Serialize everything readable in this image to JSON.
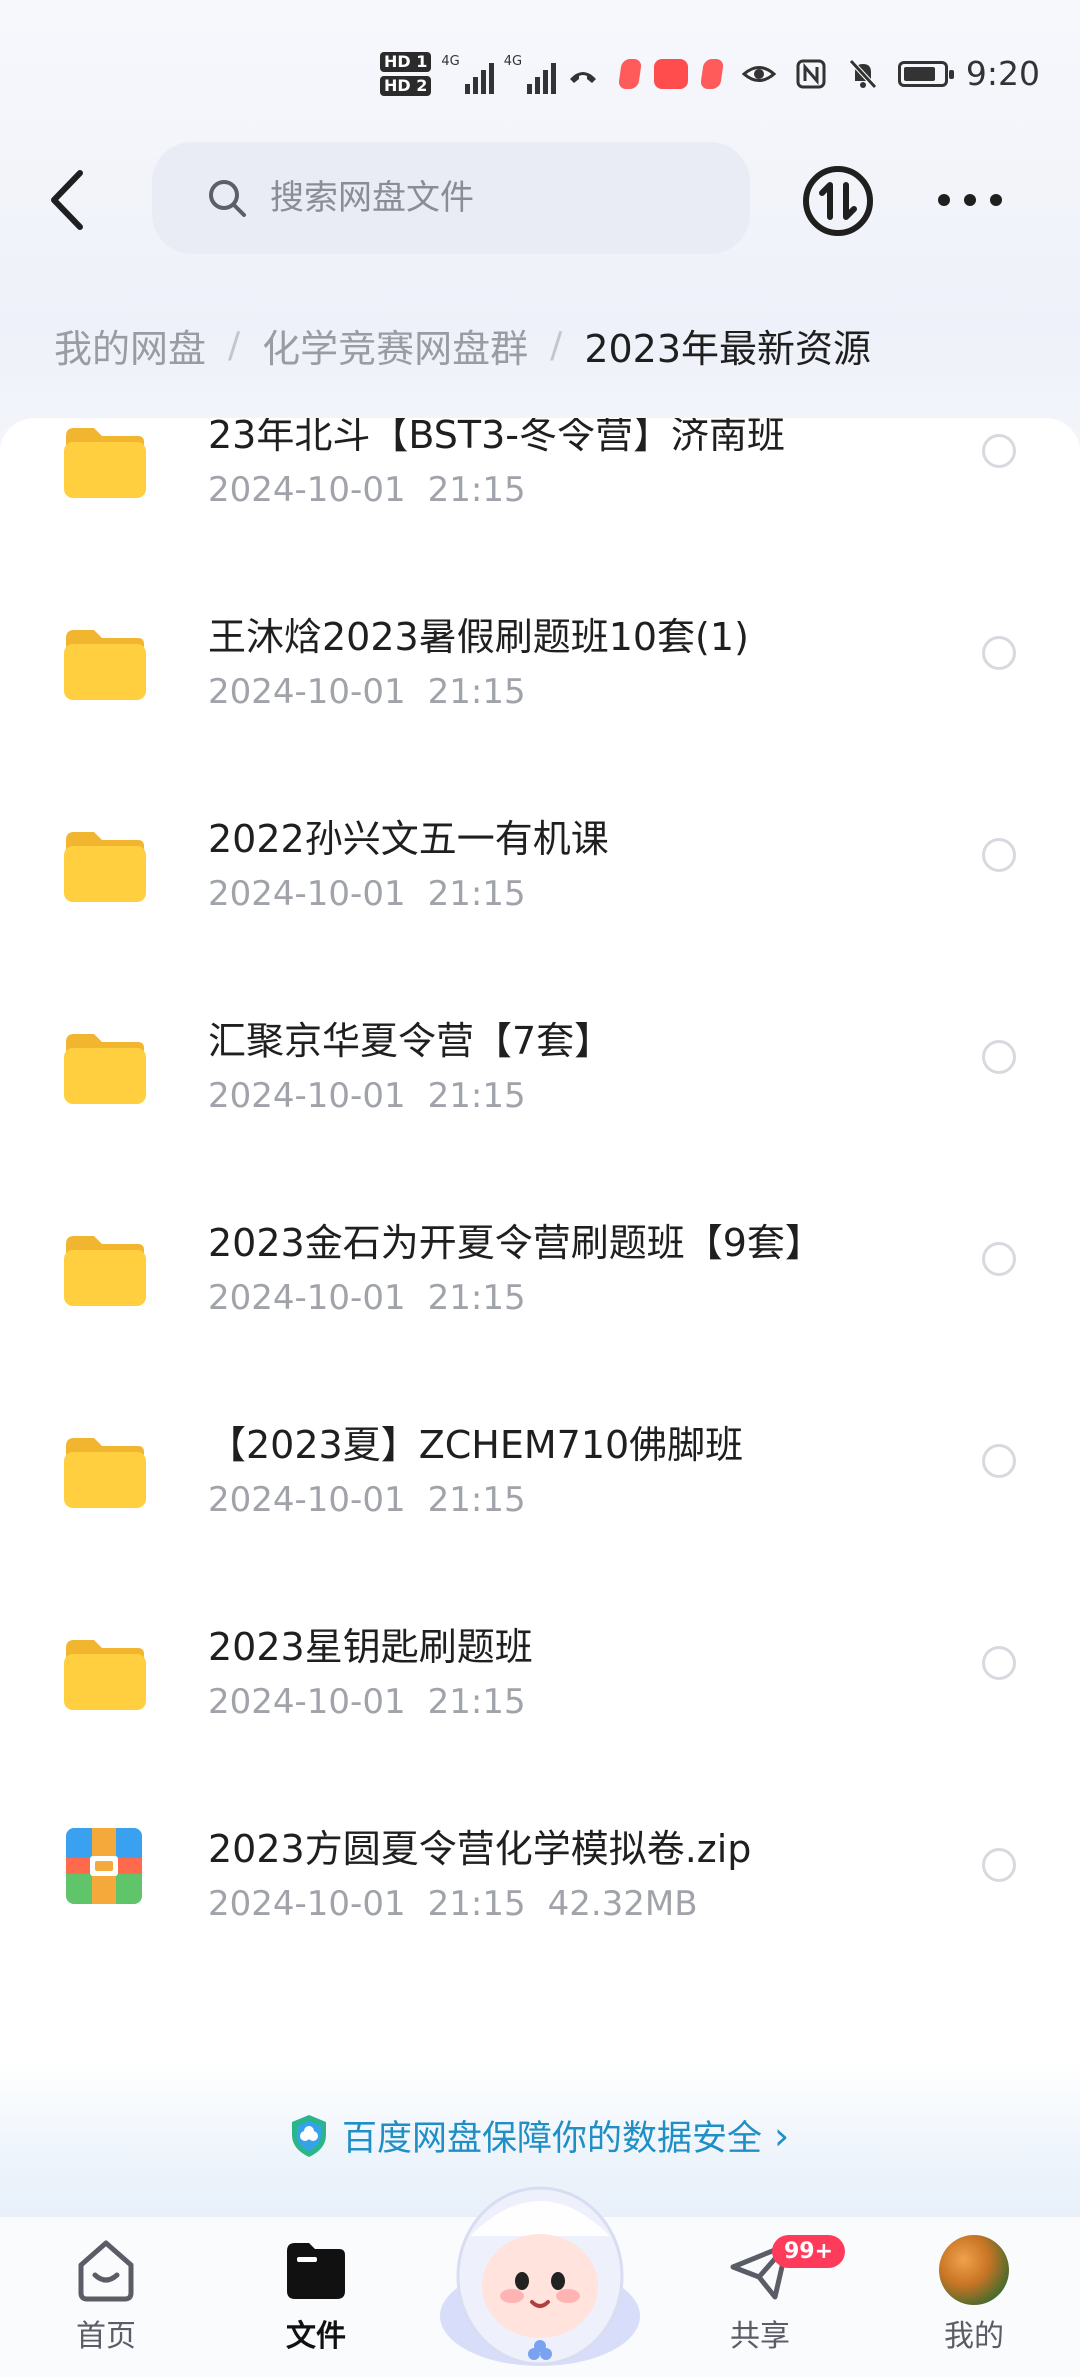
{
  "status_bar": {
    "time": "9:20",
    "hd_labels": [
      "HD 1",
      "HD 2"
    ],
    "network_labels": [
      "4G",
      "4G"
    ]
  },
  "header": {
    "search_placeholder": "搜索网盘文件"
  },
  "breadcrumb": {
    "items": [
      "我的网盘",
      "化学竞赛网盘群",
      "2023年最新资源"
    ],
    "separator": "/"
  },
  "files": [
    {
      "name": "23年北斗【BST3-冬令营】济南班",
      "date": "2024-10-01",
      "time": "21:15",
      "size": "",
      "type": "folder"
    },
    {
      "name": "王沐焓2023暑假刷题班10套(1)",
      "date": "2024-10-01",
      "time": "21:15",
      "size": "",
      "type": "folder"
    },
    {
      "name": "2022孙兴文五一有机课",
      "date": "2024-10-01",
      "time": "21:15",
      "size": "",
      "type": "folder"
    },
    {
      "name": "汇聚京华夏令营【7套】",
      "date": "2024-10-01",
      "time": "21:15",
      "size": "",
      "type": "folder"
    },
    {
      "name": "2023金石为开夏令营刷题班【9套】",
      "date": "2024-10-01",
      "time": "21:15",
      "size": "",
      "type": "folder"
    },
    {
      "name": "【2023夏】ZCHEM710佛脚班",
      "date": "2024-10-01",
      "time": "21:15",
      "size": "",
      "type": "folder"
    },
    {
      "name": "2023星钥匙刷题班",
      "date": "2024-10-01",
      "time": "21:15",
      "size": "",
      "type": "folder"
    },
    {
      "name": "2023方圆夏令营化学模拟卷.zip",
      "date": "2024-10-01",
      "time": "21:15",
      "size": "42.32MB",
      "type": "zip"
    }
  ],
  "banner": {
    "text": "百度网盘保障你的数据安全",
    "chevron": "›"
  },
  "bottom_nav": {
    "home": "首页",
    "files": "文件",
    "share": "共享",
    "share_badge": "99+",
    "mine": "我的"
  },
  "colors": {
    "folder": "#FFCF3F",
    "accent": "#1F8FC6",
    "badge": "#FF3B5C"
  }
}
